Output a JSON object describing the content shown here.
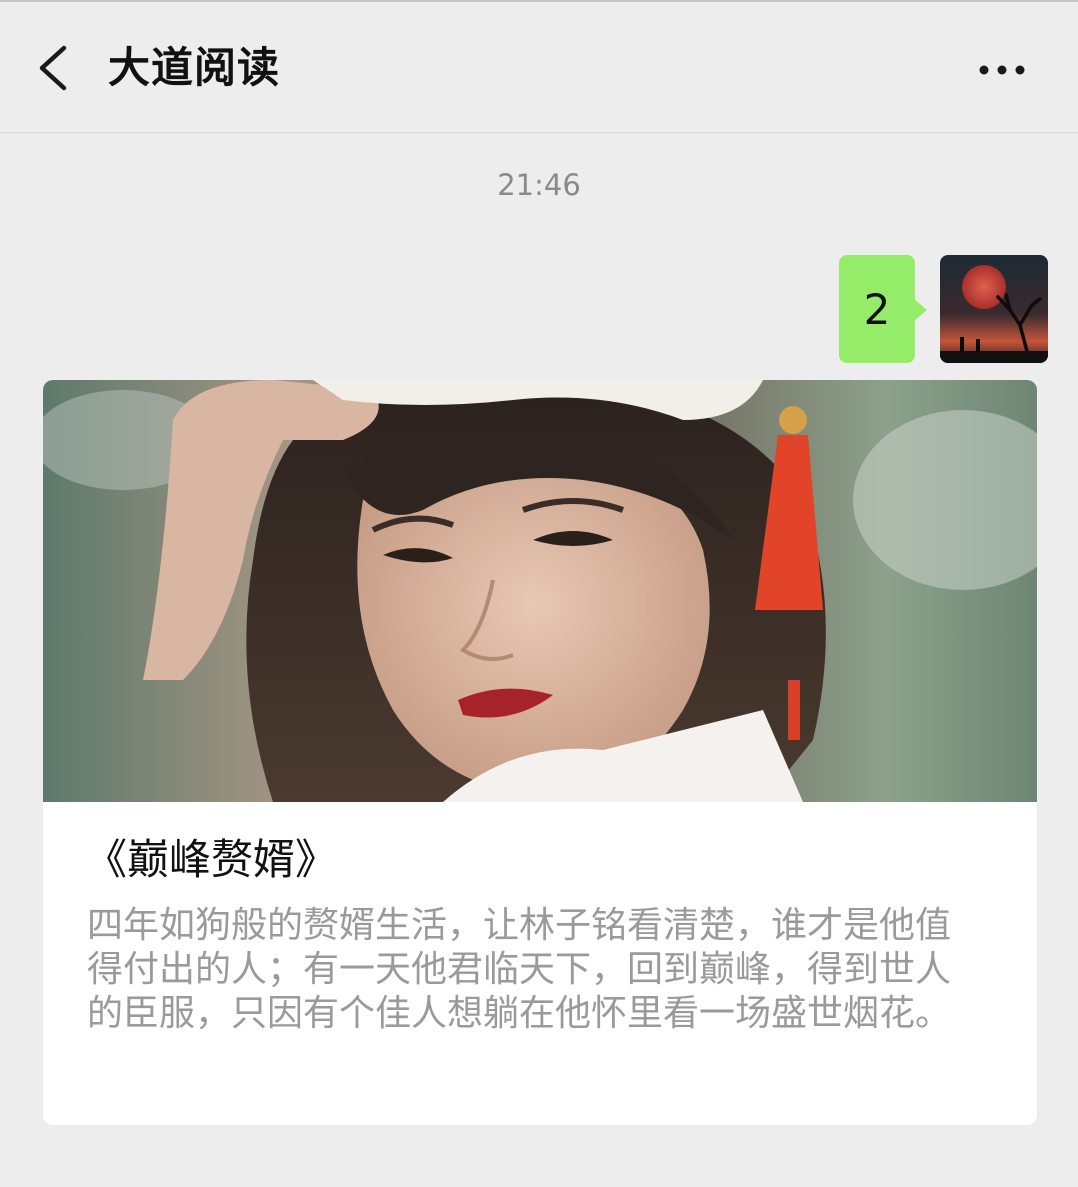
{
  "header": {
    "title": "大道阅读",
    "back_icon": "chevron-left-icon",
    "more_icon": "more-dots-icon"
  },
  "chat": {
    "timestamp": "21:46",
    "sent_message": {
      "text": "2",
      "bubble_color": "#95ec69"
    }
  },
  "article_card": {
    "title": "《巅峰赘婿》",
    "description": "四年如狗般的赘婿生活，让林子铭看清楚，谁才是他值得付出的人；有一天他君临天下，回到巅峰，得到世人的臣服，只因有个佳人想躺在他怀里看一场盛世烟花。"
  },
  "colors": {
    "background": "#ededed",
    "card": "#ffffff",
    "title_text": "#111111",
    "secondary_text": "#9a9a9a"
  }
}
